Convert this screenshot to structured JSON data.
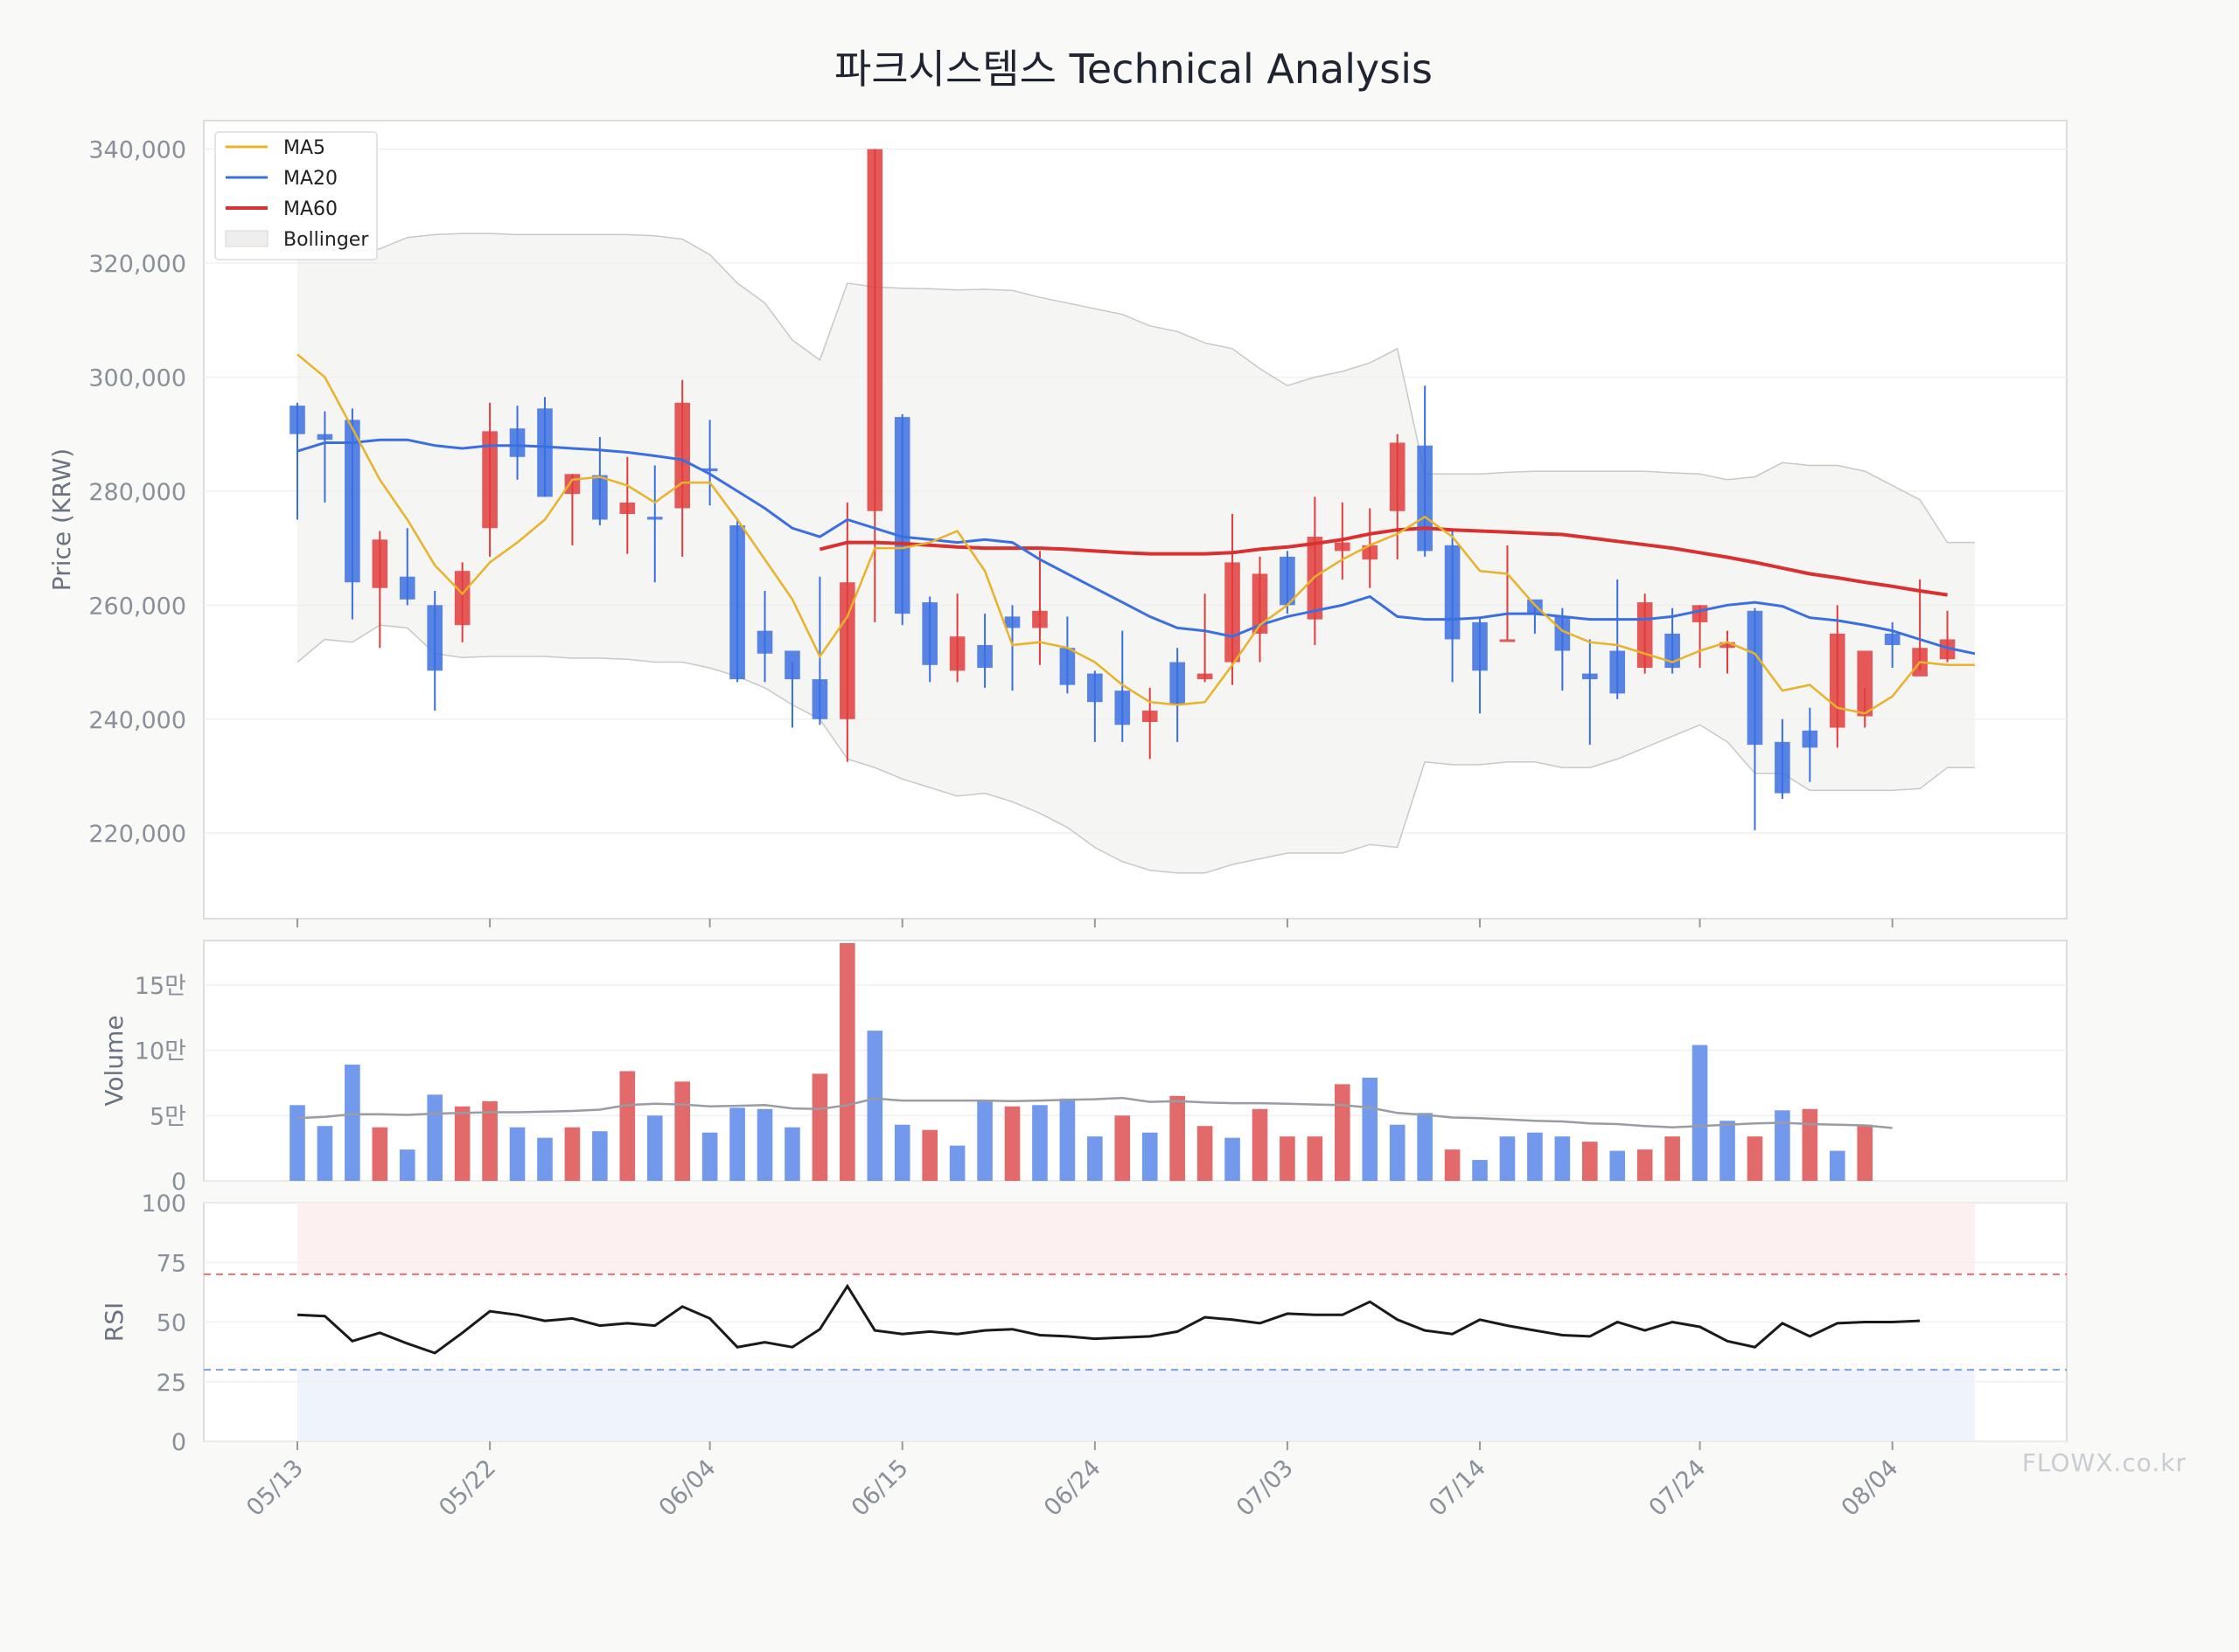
{
  "title": "파크시스템스 Technical Analysis",
  "watermark": "FLOWX.co.kr",
  "colors": {
    "up": "#e03c3c",
    "down": "#3b6fe0",
    "up_bar": "#e06262",
    "down_bar": "#6b93ec",
    "ma5": "#e8b22a",
    "ma20": "#3b6fe0",
    "ma60": "#d93030",
    "rsi": "#1a1a1a",
    "bollinger_fill": "#efeeec",
    "bollinger_line": "#c8c8c8",
    "vol_ma": "#9a9ca3"
  },
  "chart_data": [
    {
      "type": "candlestick",
      "ylabel": "Price (KRW)",
      "ylim": [
        205000,
        345000
      ],
      "yticks": [
        220000,
        240000,
        260000,
        280000,
        300000,
        320000,
        340000
      ],
      "ytick_labels": [
        "220,000",
        "240,000",
        "260,000",
        "280,000",
        "300,000",
        "320,000",
        "340,000"
      ],
      "grid": true,
      "legend": {
        "placement": "top-left",
        "entries": [
          "MA5",
          "MA20",
          "MA60",
          "Bollinger"
        ]
      },
      "x": [
        "05/13",
        "05/14",
        "05/15",
        "05/16",
        "05/19",
        "05/20",
        "05/21",
        "05/22",
        "05/23",
        "05/26",
        "05/27",
        "05/28",
        "05/29",
        "05/30",
        "06/02",
        "06/04",
        "06/05",
        "06/09",
        "06/10",
        "06/11",
        "06/12",
        "06/13",
        "06/15",
        "06/16",
        "06/17",
        "06/18",
        "06/19",
        "06/20",
        "06/23",
        "06/24",
        "06/25",
        "06/26",
        "06/27",
        "06/30",
        "07/01",
        "07/02",
        "07/03",
        "07/04",
        "07/07",
        "07/08",
        "07/09",
        "07/10",
        "07/11",
        "07/14",
        "07/15",
        "07/16",
        "07/17",
        "07/18",
        "07/21",
        "07/22",
        "07/23",
        "07/24",
        "07/25",
        "07/28",
        "07/29",
        "07/30",
        "07/31",
        "08/01",
        "08/04",
        "08/05",
        "08/06",
        "08/07"
      ],
      "open": [
        295000,
        290000,
        292500,
        263000,
        265000,
        260000,
        256500,
        273500,
        291000,
        294500,
        279500,
        282800,
        276000,
        275500,
        277000,
        284000,
        274000,
        255500,
        252000,
        247000,
        240000,
        276500,
        293000,
        260500,
        248500,
        253000,
        258000,
        256000,
        252500,
        248000,
        245000,
        239500,
        250000,
        247000,
        250000,
        255000,
        268500,
        257500,
        269500,
        268000,
        276500,
        288000,
        270500,
        257000,
        254000,
        261000,
        258000,
        248000,
        252000,
        249000,
        255000,
        257000,
        252500,
        259000,
        236000,
        238000,
        238500,
        240500,
        255000,
        247500,
        250500,
        0
      ],
      "high": [
        295500,
        294000,
        294500,
        273000,
        273500,
        262500,
        267500,
        295500,
        295000,
        296500,
        283000,
        289500,
        286000,
        284500,
        299500,
        292500,
        275000,
        262500,
        250000,
        265000,
        278000,
        340000,
        293500,
        261500,
        262000,
        258500,
        260000,
        269500,
        258000,
        248500,
        255500,
        245500,
        252500,
        262000,
        276000,
        268500,
        269500,
        279000,
        278000,
        277000,
        290000,
        298500,
        273000,
        258000,
        270500,
        260000,
        259500,
        254000,
        264500,
        262000,
        259500,
        260000,
        255500,
        259500,
        240000,
        242000,
        260000,
        245500,
        257000,
        264500,
        259000,
        0
      ],
      "low": [
        275000,
        278000,
        257500,
        252500,
        260000,
        241500,
        253500,
        268500,
        282000,
        279000,
        270500,
        274000,
        269000,
        264000,
        268500,
        277500,
        246500,
        246500,
        238500,
        239000,
        232500,
        257000,
        256500,
        246500,
        246500,
        245500,
        245000,
        249500,
        244500,
        236000,
        236000,
        233000,
        236000,
        246500,
        246000,
        250000,
        258500,
        253000,
        264500,
        263000,
        268000,
        268500,
        246500,
        241000,
        254000,
        255000,
        245000,
        235500,
        243500,
        248000,
        248000,
        249000,
        248000,
        220500,
        226000,
        229000,
        235000,
        238500,
        249000,
        248500,
        250000,
        0
      ],
      "close": [
        290000,
        289000,
        264000,
        271500,
        261000,
        248500,
        266000,
        290500,
        286000,
        279000,
        283000,
        275000,
        278000,
        275000,
        295500,
        283500,
        247000,
        251500,
        247000,
        240000,
        264000,
        340000,
        258500,
        249500,
        254500,
        249000,
        256000,
        259000,
        246000,
        243000,
        239000,
        241500,
        242500,
        248000,
        267500,
        265500,
        260000,
        272000,
        271000,
        270500,
        288500,
        269500,
        254000,
        248500,
        254000,
        258500,
        252000,
        247000,
        244500,
        260500,
        249000,
        260000,
        253500,
        235500,
        227000,
        235000,
        255000,
        252000,
        253000,
        252500,
        254000,
        0
      ],
      "ma5": [
        304000,
        300000,
        291000,
        282000,
        275000,
        267000,
        262000,
        267500,
        271000,
        275000,
        282000,
        282500,
        281000,
        278000,
        281500,
        281500,
        275000,
        268000,
        261000,
        251000,
        258000,
        270000,
        270000,
        271000,
        273000,
        266000,
        253000,
        253500,
        252500,
        250000,
        246000,
        243000,
        242500,
        243000,
        249500,
        256500,
        260000,
        265000,
        268000,
        270500,
        272500,
        275500,
        272000,
        266000,
        265500,
        260000,
        255500,
        253500,
        253000,
        251500,
        250000,
        252000,
        253500,
        251500,
        245000,
        246000,
        242000,
        241000,
        244000,
        250000,
        249500,
        249500
      ],
      "ma20": [
        287000,
        288500,
        288500,
        289000,
        289000,
        288000,
        287500,
        288000,
        288000,
        287800,
        287500,
        287200,
        286800,
        286200,
        285500,
        283000,
        280000,
        277000,
        273500,
        272000,
        275000,
        273500,
        272000,
        271500,
        271000,
        271500,
        271000,
        268000,
        265500,
        263000,
        260500,
        258000,
        256000,
        255500,
        254500,
        256500,
        258000,
        259000,
        260000,
        261500,
        258000,
        257500,
        257500,
        257800,
        258500,
        258500,
        258000,
        257500,
        257500,
        257500,
        258000,
        259000,
        260000,
        260500,
        259800,
        257800,
        257300,
        256500,
        255500,
        254000,
        252500,
        251500
      ],
      "ma60": [
        null,
        null,
        null,
        null,
        null,
        null,
        null,
        null,
        null,
        null,
        null,
        null,
        null,
        null,
        null,
        null,
        null,
        null,
        null,
        269800,
        271000,
        271000,
        270800,
        270500,
        270200,
        270000,
        270000,
        270000,
        269800,
        269500,
        269200,
        269000,
        269000,
        269000,
        269200,
        269800,
        270200,
        270800,
        271500,
        272500,
        273200,
        273500,
        273200,
        273000,
        272800,
        272600,
        272400,
        271800,
        271200,
        270600,
        270000,
        269200,
        268400,
        267500,
        266500,
        265500,
        264800,
        264000,
        263300,
        262500,
        261800
      ],
      "bollinger_upper": [
        322000,
        322500,
        322000,
        322500,
        324500,
        325000,
        325200,
        325200,
        325000,
        325000,
        325000,
        325000,
        325000,
        324800,
        324200,
        321500,
        316500,
        313000,
        306500,
        303000,
        316500,
        315800,
        315600,
        315500,
        315300,
        315400,
        315200,
        314000,
        313000,
        312000,
        311000,
        309000,
        308000,
        306000,
        305000,
        301500,
        298500,
        300000,
        301000,
        302500,
        305000,
        283000,
        283000,
        283000,
        283300,
        283500,
        283500,
        283500,
        283500,
        283500,
        283200,
        283000,
        282000,
        282500,
        285000,
        284500,
        284500,
        283500,
        281000,
        278500,
        271000,
        271000
      ],
      "bollinger_lower": [
        250000,
        254000,
        253500,
        256500,
        256000,
        251500,
        250800,
        251000,
        251000,
        251000,
        250700,
        250700,
        250500,
        250000,
        250000,
        249000,
        247500,
        245500,
        242500,
        240000,
        233000,
        231500,
        229500,
        228000,
        226500,
        227000,
        225500,
        223500,
        221000,
        217500,
        215000,
        213500,
        213000,
        213000,
        214500,
        215500,
        216500,
        216500,
        216500,
        218000,
        217500,
        232500,
        232000,
        232000,
        232500,
        232500,
        231500,
        231500,
        233000,
        235000,
        237000,
        239000,
        236000,
        230500,
        230500,
        227500,
        227500,
        227500,
        227500,
        227800,
        231500,
        231500
      ],
      "ohlc_note": ""
    },
    {
      "type": "bar",
      "ylabel": "Volume",
      "ylim": [
        0,
        184000
      ],
      "yticks": [
        0,
        50000,
        100000,
        150000
      ],
      "ytick_labels": [
        "0",
        "5만",
        "10만",
        "15만"
      ],
      "values": [
        58000,
        42000,
        89000,
        41000,
        24000,
        66000,
        57000,
        61000,
        41000,
        33000,
        41000,
        38000,
        84000,
        50000,
        76000,
        37000,
        56000,
        55000,
        41000,
        82000,
        182000,
        115000,
        43000,
        39000,
        27000,
        61000,
        57000,
        58000,
        63000,
        34000,
        50000,
        37000,
        65000,
        42000,
        33000,
        55000,
        34000,
        34000,
        74000,
        79000,
        43000,
        52000,
        24000,
        16000,
        34000,
        37000,
        34000,
        30000,
        23000,
        24000,
        34000,
        104000,
        46000,
        34000,
        54000,
        55000,
        23000,
        43000,
        0
      ],
      "up": [
        false,
        false,
        false,
        true,
        false,
        false,
        true,
        true,
        false,
        false,
        true,
        false,
        true,
        false,
        true,
        false,
        false,
        false,
        false,
        true,
        true,
        false,
        false,
        true,
        false,
        false,
        true,
        false,
        false,
        false,
        true,
        false,
        true,
        true,
        false,
        true,
        true,
        true,
        true,
        false,
        false,
        false,
        true,
        false,
        false,
        false,
        false,
        true,
        false,
        true,
        true,
        false,
        false,
        true,
        false,
        true,
        false,
        true,
        true
      ],
      "ma": [
        48000,
        49000,
        51000,
        51000,
        50500,
        51500,
        52000,
        52500,
        52500,
        53000,
        53500,
        54500,
        58000,
        59000,
        58500,
        57000,
        57500,
        58000,
        55500,
        55000,
        58000,
        63000,
        61500,
        61500,
        61500,
        61500,
        61000,
        61500,
        62000,
        62500,
        63500,
        60500,
        61000,
        60000,
        59500,
        59500,
        59000,
        58500,
        58000,
        56000,
        52000,
        50500,
        48500,
        48000,
        47000,
        46000,
        45500,
        44000,
        43500,
        42000,
        41000,
        42000,
        43000,
        44000,
        44500,
        43500,
        43000,
        42500,
        40500
      ]
    },
    {
      "type": "line",
      "ylabel": "RSI",
      "ylim": [
        0,
        100
      ],
      "yticks": [
        0,
        25,
        50,
        75,
        100
      ],
      "ytick_labels": [
        "0",
        "25",
        "50",
        "75",
        "100"
      ],
      "overbought": 70,
      "oversold": 30,
      "values": [
        53,
        52.5,
        42,
        45.5,
        41,
        37,
        45.5,
        54.5,
        53,
        50.5,
        51.5,
        48.5,
        49.5,
        48.5,
        56.5,
        51.5,
        39.5,
        41.5,
        39.5,
        47,
        65,
        46.5,
        45,
        46,
        45,
        46.5,
        47,
        44.5,
        44,
        43,
        43.5,
        44,
        46,
        52,
        51,
        49.5,
        53.5,
        53,
        53,
        58.5,
        51,
        46.5,
        45,
        51,
        48.5,
        46.5,
        44.5,
        44,
        50,
        46.5,
        50,
        48,
        42,
        39.5,
        49.5,
        44,
        49.5,
        50,
        50,
        50.5
      ],
      "x_tick_labels": [
        "05/13",
        "05/22",
        "06/04",
        "06/15",
        "06/24",
        "07/03",
        "07/14",
        "07/24",
        "08/04"
      ]
    }
  ]
}
